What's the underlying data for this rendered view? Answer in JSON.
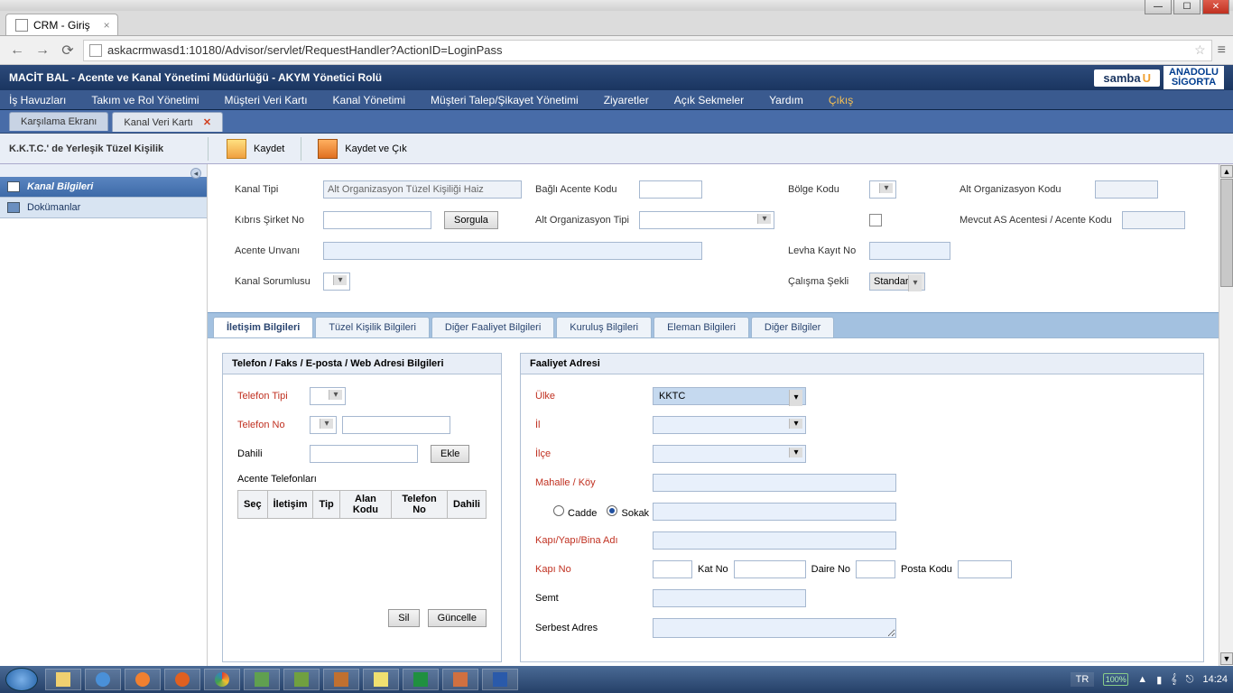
{
  "browser": {
    "tab_title": "CRM - Giriş",
    "url": "askacrmwasd1:10180/Advisor/servlet/RequestHandler?ActionID=LoginPass"
  },
  "header_title": "MACİT BAL - Acente ve Kanal Yönetimi Müdürlüğü - AKYM Yönetici Rolü",
  "logo": {
    "samba": "samba",
    "anadolu_l1": "ANADOLU",
    "anadolu_l2": "SİGORTA"
  },
  "menu": [
    "İş Havuzları",
    "Takım ve Rol Yönetimi",
    "Müşteri Veri Kartı",
    "Kanal Yönetimi",
    "Müşteri Talep/Şikayet Yönetimi",
    "Ziyaretler",
    "Açık Sekmeler",
    "Yardım",
    "Çıkış"
  ],
  "ws_tabs": [
    {
      "label": "Karşılama Ekranı",
      "closable": false
    },
    {
      "label": "Kanal Veri Kartı",
      "closable": true
    }
  ],
  "breadcrumb": "K.K.T.C.' de Yerleşik Tüzel Kişilik",
  "toolbar": {
    "save": "Kaydet",
    "save_exit": "Kaydet ve Çık"
  },
  "sidebar": {
    "items": [
      {
        "label": "Kanal Bilgileri",
        "active": true
      },
      {
        "label": "Dokümanlar",
        "active": false
      }
    ]
  },
  "form": {
    "kanal_tipi_label": "Kanal Tipi",
    "kanal_tipi_value": "Alt Organizasyon Tüzel Kişiliği Haiz",
    "bagli_acente_label": "Bağlı Acente Kodu",
    "bolge_kodu_label": "Bölge Kodu",
    "alt_org_kodu_label": "Alt Organizasyon Kodu",
    "kibris_sirket_label": "Kıbrıs Şirket No",
    "sorgula_btn": "Sorgula",
    "alt_org_tipi_label": "Alt Organizasyon Tipi",
    "mevcut_as_label": "Mevcut AS Acentesi / Acente Kodu",
    "acente_unvani_label": "Acente Unvanı",
    "levha_label": "Levha Kayıt No",
    "kanal_sorumlusu_label": "Kanal Sorumlusu",
    "calisma_sekli_label": "Çalışma Şekli",
    "calisma_sekli_value": "Standart"
  },
  "inner_tabs": [
    "İletişim Bilgileri",
    "Tüzel Kişilik Bilgileri",
    "Diğer Faaliyet Bilgileri",
    "Kuruluş Bilgileri",
    "Eleman Bilgileri",
    "Diğer Bilgiler"
  ],
  "group1": {
    "title": "Telefon / Faks / E-posta / Web Adresi Bilgileri",
    "telefon_tipi": "Telefon Tipi",
    "telefon_no": "Telefon No",
    "dahili": "Dahili",
    "ekle": "Ekle",
    "acente_tel": "Acente Telefonları",
    "cols": [
      "Seç",
      "İletişim",
      "Tip",
      "Alan Kodu",
      "Telefon No",
      "Dahili"
    ],
    "sil": "Sil",
    "guncelle": "Güncelle"
  },
  "group2": {
    "title": "Faaliyet Adresi",
    "ulke": "Ülke",
    "ulke_value": "KKTC",
    "il": "İl",
    "ilce": "İlçe",
    "mahalle": "Mahalle / Köy",
    "cadde": "Cadde",
    "sokak": "Sokak",
    "kapi_yapi": "Kapı/Yapı/Bina Adı",
    "kapi_no": "Kapı No",
    "kat_no": "Kat No",
    "daire_no": "Daire No",
    "posta_kodu": "Posta Kodu",
    "semt": "Semt",
    "serbest_adres": "Serbest Adres"
  },
  "systray": {
    "lang": "TR",
    "battery": "100%",
    "time": "14:24"
  }
}
